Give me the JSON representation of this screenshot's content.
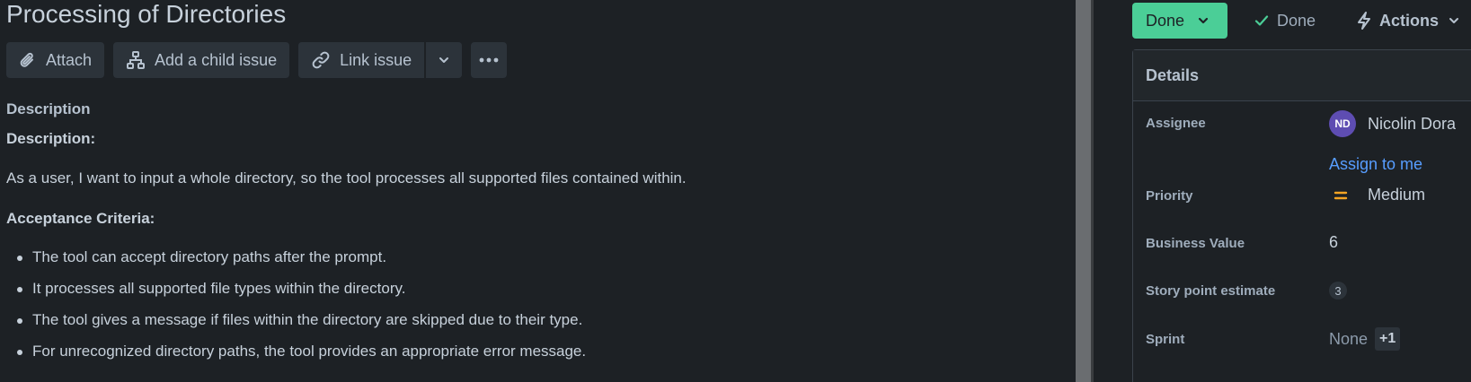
{
  "issue": {
    "title": "Processing of Directories"
  },
  "toolbar": {
    "attach_label": "Attach",
    "child_issue_label": "Add a child issue",
    "link_issue_label": "Link issue"
  },
  "description": {
    "section_label": "Description",
    "heading": "Description:",
    "text": "As a user, I want to input a whole directory, so the tool processes all supported files contained within.",
    "acceptance_heading": "Acceptance Criteria:",
    "criteria": [
      "The tool can accept directory paths after the prompt.",
      "It processes all supported file types within the directory.",
      "The tool gives a message if files within the directory are skipped due to their type.",
      "For unrecognized directory paths, the tool provides an appropriate error message."
    ]
  },
  "status": {
    "button_label": "Done",
    "resolution_label": "Done",
    "actions_label": "Actions"
  },
  "details": {
    "heading": "Details",
    "assignee_label": "Assignee",
    "assignee_initials": "ND",
    "assignee_name": "Nicolin Dora",
    "assign_to_me": "Assign to me",
    "priority_label": "Priority",
    "priority_value": "Medium",
    "business_value_label": "Business Value",
    "business_value": "6",
    "story_points_label": "Story point estimate",
    "story_points": "3",
    "sprint_label": "Sprint",
    "sprint_value": "None",
    "sprint_extra": "+1"
  },
  "icons": [
    "paperclip-icon",
    "hierarchy-icon",
    "link-icon",
    "chevron-down-icon",
    "more-icon",
    "check-icon",
    "lightning-icon",
    "priority-medium-icon"
  ],
  "colors": {
    "background": "#1d2125",
    "status_done": "#4bce97",
    "link": "#579dff",
    "avatar": "#5e4db2",
    "priority_medium": "#f5a524"
  }
}
